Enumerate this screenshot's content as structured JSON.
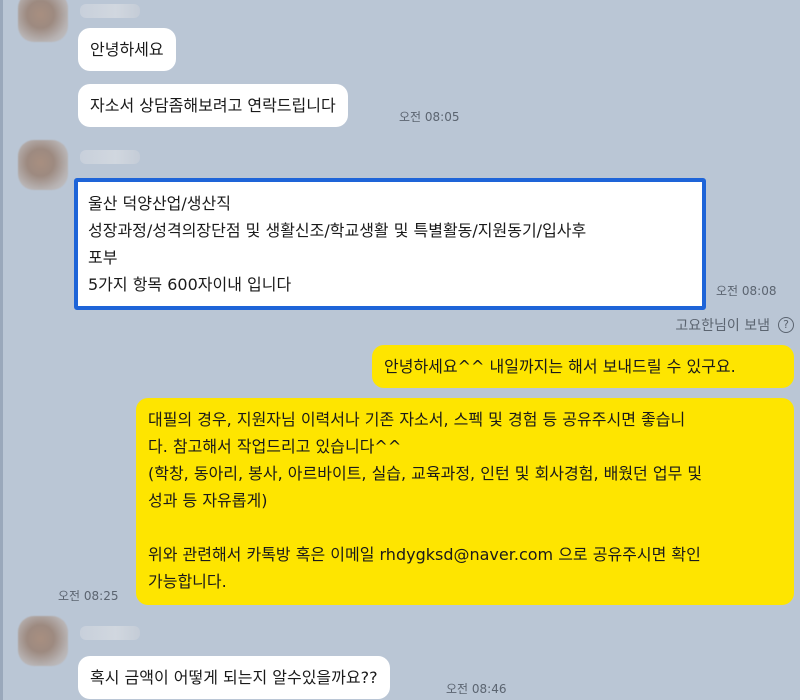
{
  "messages": [
    {
      "id": "m1",
      "text": "안녕하세요"
    },
    {
      "id": "m2",
      "text": "자소서 상담좀해보려고 연락드립니다",
      "time": "오전 08:05"
    },
    {
      "id": "m3",
      "lines": [
        "울산 덕양산업/생산직",
        "성장과정/성격의장단점 및 생활신조/학교생활 및 특별활동/지원동기/입사후",
        "포부",
        "5가지 항목 600자이내 입니다"
      ],
      "time": "오전 08:08"
    },
    {
      "id": "m4",
      "text": "안녕하세요^^ 내일까지는 해서 보내드릴 수 있구요."
    },
    {
      "id": "m5",
      "lines": [
        "대필의 경우, 지원자님 이력서나 기존 자소서, 스펙 및 경험 등 공유주시면 좋습니",
        "다. 참고해서 작업드리고 있습니다^^",
        "(학창, 동아리, 봉사, 아르바이트, 실습, 교육과정, 인턴 및 회사경험, 배웠던 업무 및",
        "성과 등 자유롭게)",
        "",
        "위와 관련해서 카톡방 혹은 이메일 rhdygksd@naver.com 으로 공유주시면 확인",
        "가능합니다."
      ],
      "time": "오전 08:25"
    },
    {
      "id": "m6",
      "text": "혹시 금액이 어떻게 되는지 알수있을까요??",
      "time": "오전 08:46"
    }
  ],
  "read_receipt": {
    "text": "고요한님이 보냄",
    "icon": "help-circle-icon",
    "glyph": "?"
  },
  "colors": {
    "background": "#bac6d5",
    "my_bubble": "#fee500",
    "their_bubble": "#ffffff",
    "highlight_border": "#1e64d8"
  }
}
